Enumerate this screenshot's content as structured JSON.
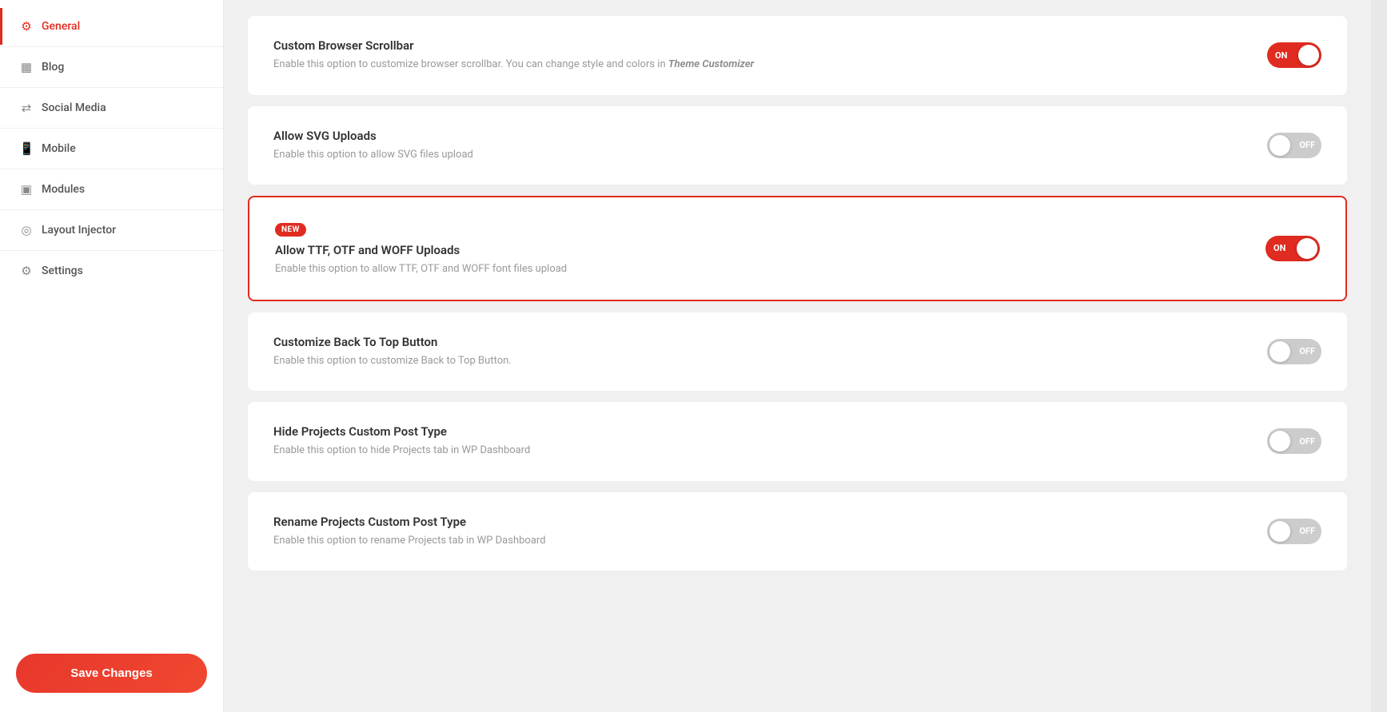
{
  "sidebar": {
    "items": [
      {
        "id": "general",
        "label": "General",
        "icon": "⚙",
        "active": true
      },
      {
        "id": "blog",
        "label": "Blog",
        "icon": "▦"
      },
      {
        "id": "social-media",
        "label": "Social Media",
        "icon": "⇄"
      },
      {
        "id": "mobile",
        "label": "Mobile",
        "icon": "📱"
      },
      {
        "id": "modules",
        "label": "Modules",
        "icon": "▣"
      },
      {
        "id": "layout-injector",
        "label": "Layout Injector",
        "icon": "◎"
      },
      {
        "id": "settings",
        "label": "Settings",
        "icon": "⚙"
      }
    ],
    "save_button_label": "Save Changes"
  },
  "settings": [
    {
      "id": "custom-browser-scrollbar",
      "title": "Custom Browser Scrollbar",
      "description": "Enable this option to customize browser scrollbar. You can change style and colors in ",
      "description_link": "Theme Customizer",
      "state": "on",
      "badge": null,
      "highlighted": false
    },
    {
      "id": "allow-svg-uploads",
      "title": "Allow SVG Uploads",
      "description": "Enable this option to allow SVG files upload",
      "state": "off",
      "badge": null,
      "highlighted": false
    },
    {
      "id": "allow-ttf-otf-woff",
      "title": "Allow TTF, OTF and WOFF Uploads",
      "description": "Enable this option to allow TTF, OTF and WOFF font files upload",
      "state": "on",
      "badge": "NEW",
      "highlighted": true
    },
    {
      "id": "customize-back-to-top",
      "title": "Customize Back To Top Button",
      "description": "Enable this option to customize Back to Top Button.",
      "state": "off",
      "badge": null,
      "highlighted": false
    },
    {
      "id": "hide-projects-custom-post-type",
      "title": "Hide Projects Custom Post Type",
      "description": "Enable this option to hide Projects tab in WP Dashboard",
      "state": "off",
      "badge": null,
      "highlighted": false
    },
    {
      "id": "rename-projects-custom-post-type",
      "title": "Rename Projects Custom Post Type",
      "description": "Enable this option to rename Projects tab in WP Dashboard",
      "state": "off",
      "badge": null,
      "highlighted": false
    }
  ],
  "labels": {
    "on": "ON",
    "off": "OFF"
  }
}
